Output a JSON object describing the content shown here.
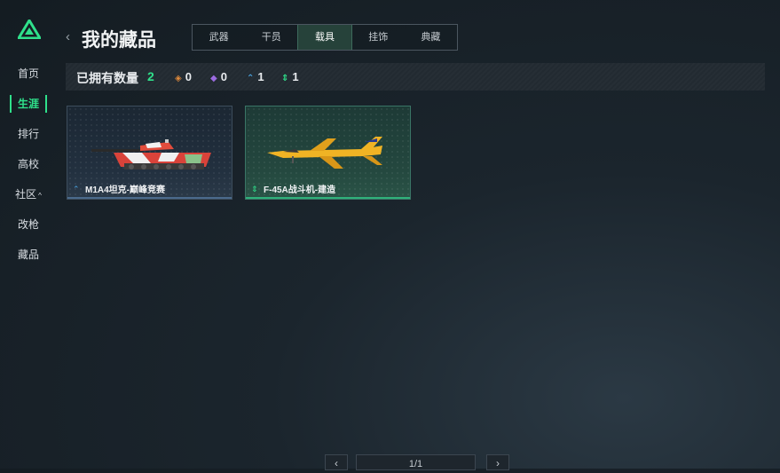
{
  "sidebar": {
    "items": [
      {
        "label": "首页"
      },
      {
        "label": "生涯"
      },
      {
        "label": "排行"
      },
      {
        "label": "高校"
      },
      {
        "label": "社区",
        "arrow": "^"
      },
      {
        "label": "改枪"
      },
      {
        "label": "藏品"
      }
    ],
    "active_index": 1
  },
  "header": {
    "back_icon": "‹",
    "title": "我的藏品"
  },
  "tabs": [
    {
      "label": "武器"
    },
    {
      "label": "干员"
    },
    {
      "label": "载具"
    },
    {
      "label": "挂饰"
    },
    {
      "label": "典藏"
    }
  ],
  "active_tab": 2,
  "stats": {
    "owned_label": "已拥有数量",
    "owned_count": "2",
    "rarities": [
      {
        "icon": "orange-diamond-icon",
        "glyph": "◈",
        "color": "#e08a3c",
        "count": "0"
      },
      {
        "icon": "purple-diamond-icon",
        "glyph": "◆",
        "color": "#9b6be0",
        "count": "0"
      },
      {
        "icon": "blue-chevron-icon",
        "glyph": "⌃",
        "color": "#4aa3e0",
        "count": "1"
      },
      {
        "icon": "green-arrows-icon",
        "glyph": "⇕",
        "color": "#2fe08b",
        "count": "1"
      }
    ]
  },
  "items": [
    {
      "name": "M1A4坦克-巅峰竞赛",
      "gem_glyph": "⌃",
      "gem_color": "#4aa3e0"
    },
    {
      "name": "F-45A战斗机-建造",
      "gem_glyph": "⇕",
      "gem_color": "#2fe08b"
    }
  ],
  "pagination": {
    "prev": "‹",
    "page": "1/1",
    "next": "›"
  },
  "colors": {
    "accent": "#2fe08b"
  }
}
